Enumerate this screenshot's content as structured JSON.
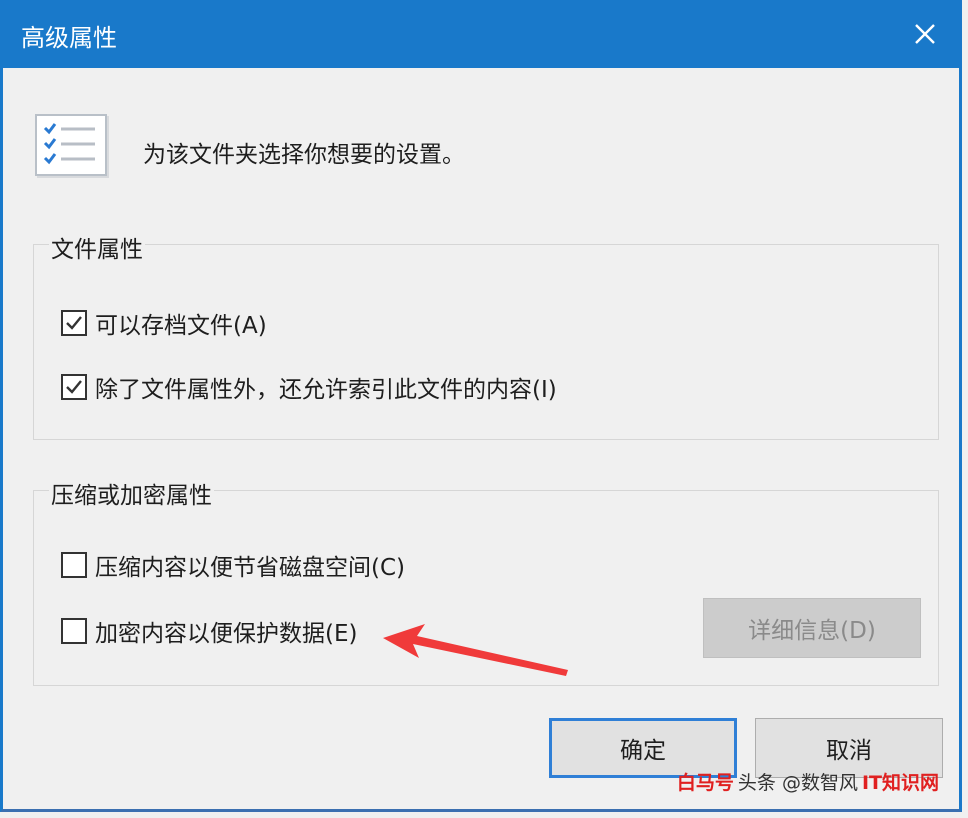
{
  "window": {
    "title": "高级属性",
    "close_icon": "close-icon"
  },
  "header": {
    "icon": "checklist-icon",
    "description": "为该文件夹选择你想要的设置。"
  },
  "file_attributes": {
    "legend": "文件属性",
    "options": [
      {
        "label": "可以存档文件(A)",
        "checked": true
      },
      {
        "label": "除了文件属性外，还允许索引此文件的内容(I)",
        "checked": true
      }
    ]
  },
  "compress_encrypt": {
    "legend": "压缩或加密属性",
    "options": [
      {
        "label": "压缩内容以便节省磁盘空间(C)",
        "checked": false
      },
      {
        "label": "加密内容以便保护数据(E)",
        "checked": false
      }
    ],
    "details_button": "详细信息(D)"
  },
  "buttons": {
    "ok": "确定",
    "cancel": "取消"
  },
  "watermark": {
    "brand": "白马号",
    "text": "头条 @数智风",
    "brand2": "IT知识网"
  },
  "colors": {
    "titlebar": "#1979ca",
    "accent": "#2f7fd6",
    "annotation_arrow": "#f03a3a"
  }
}
